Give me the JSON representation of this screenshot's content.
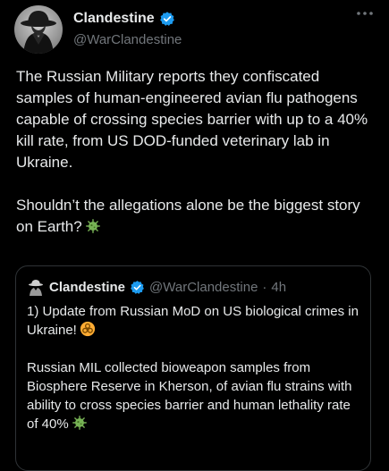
{
  "tweet": {
    "display_name": "Clandestine",
    "handle": "@WarClandestine",
    "paragraphs": [
      "The Russian Military reports they confiscated samples of human-engineered avian flu pathogens capable of crossing species barrier with up to a 40% kill rate, from US DOD-funded veterinary lab in Ukraine.",
      "Shouldn’t the allegations alone be the biggest story on Earth?"
    ],
    "icons": {
      "verified": "verified-badge-icon",
      "more": "more-options-icon",
      "emoji": "microbe-emoji-icon"
    }
  },
  "quote": {
    "display_name": "Clandestine",
    "handle": "@WarClandestine",
    "separator": "·",
    "time": "4h",
    "paragraphs": [
      "1) Update from Russian MoD on US biological crimes in Ukraine!",
      "Russian MIL collected bioweapon samples from Biosphere Reserve in Kherson, of avian flu strains with ability to cross species barrier and human lethality rate of 40%"
    ],
    "icons": {
      "biohazard": "biohazard-emoji-icon",
      "microbe": "microbe-emoji-icon"
    }
  },
  "colors": {
    "background": "#000000",
    "text": "#e7e9ea",
    "secondary_text": "#71767b",
    "verified_blue": "#1d9bf0",
    "border": "#2f3336"
  }
}
